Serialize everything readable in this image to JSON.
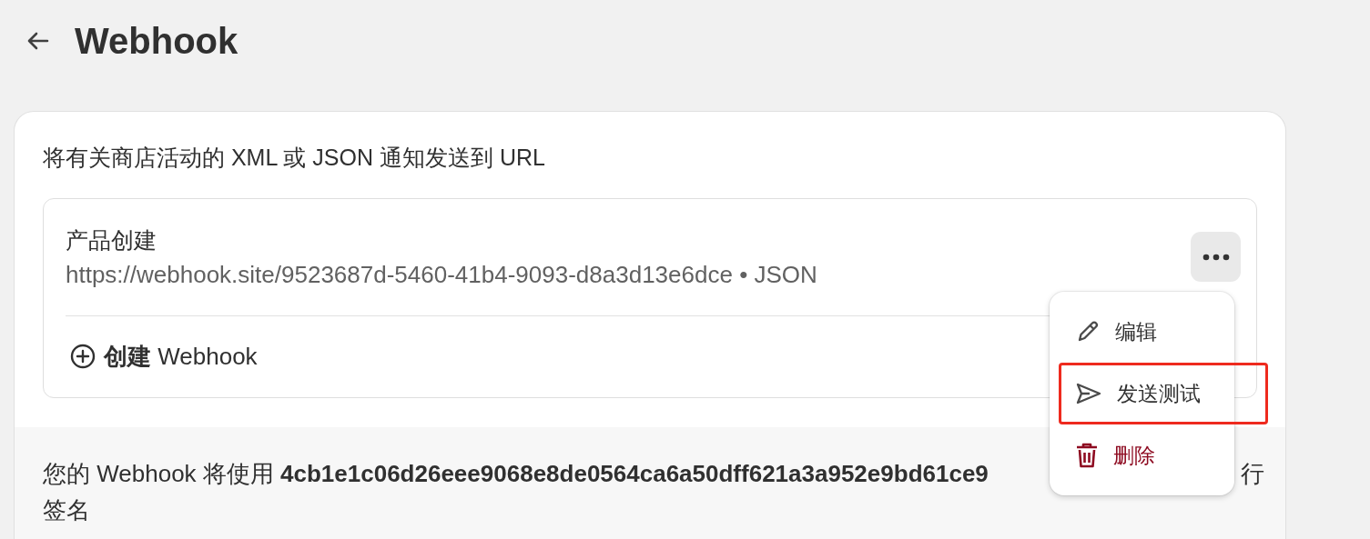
{
  "page": {
    "title": "Webhook"
  },
  "card": {
    "description": "将有关商店活动的 XML 或 JSON 通知发送到 URL",
    "webhooks": [
      {
        "name": "产品创建",
        "url": "https://webhook.site/9523687d-5460-41b4-9093-d8a3d13e6dce • JSON"
      }
    ],
    "create_action": "**创建** Webhook",
    "footer": {
      "line_1": "您的 Webhook 将使用 **4cb1e1c06d26eee9068e8de0564ca6a50dff621a3a952e9bd61ce9**",
      "line_1_end": "行",
      "line_2": "签名"
    }
  },
  "menu": {
    "items": [
      {
        "kind": "edit",
        "label": "编辑",
        "highlighted": false,
        "destructive": false
      },
      {
        "kind": "send",
        "label": "发送测试",
        "highlighted": true,
        "destructive": false
      },
      {
        "kind": "delete",
        "label": "删除",
        "highlighted": false,
        "destructive": true
      }
    ]
  }
}
